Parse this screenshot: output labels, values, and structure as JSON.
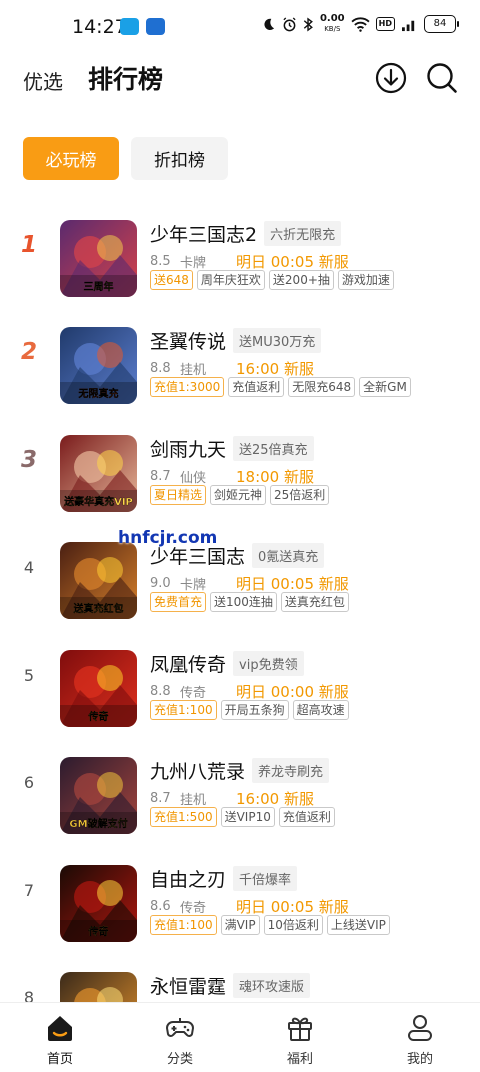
{
  "status_bar": {
    "time": "14:27",
    "net_speed": "0.00",
    "net_unit": "KB/S",
    "hd": "HD",
    "signal": "5G",
    "battery": "84"
  },
  "header": {
    "tab_featured": "优选",
    "tab_ranking": "排行榜",
    "icons": [
      "download-icon",
      "search-icon"
    ]
  },
  "segments": {
    "must_play": "必玩榜",
    "discount": "折扣榜"
  },
  "colors": {
    "accent": "#f99c14",
    "open_time": "#f29800",
    "watermark": "#1337b3"
  },
  "games": [
    {
      "rank": "1",
      "name": "少年三国志2",
      "subtitle": "六折无限充",
      "score": "8.5",
      "genre": "卡牌",
      "open_time": "明日 00:05 新服",
      "tags": [
        {
          "text": "送648",
          "highlight": true
        },
        {
          "text": "周年庆狂欢",
          "highlight": false
        },
        {
          "text": "送200+抽",
          "highlight": false
        },
        {
          "text": "游戏加速",
          "highlight": false
        }
      ],
      "thumb_text": "三周年"
    },
    {
      "rank": "2",
      "name": "圣翼传说",
      "subtitle": "送MU30万充",
      "score": "8.8",
      "genre": "挂机",
      "open_time": "16:00 新服",
      "tags": [
        {
          "text": "充值1:3000",
          "highlight": true
        },
        {
          "text": "充值返利",
          "highlight": false
        },
        {
          "text": "无限充648",
          "highlight": false
        },
        {
          "text": "全新GM",
          "highlight": false
        }
      ],
      "thumb_text": "无限真充"
    },
    {
      "rank": "3",
      "name": "剑雨九天",
      "subtitle": "送25倍真充",
      "score": "8.7",
      "genre": "仙侠",
      "open_time": "18:00 新服",
      "tags": [
        {
          "text": "夏日精选",
          "highlight": true
        },
        {
          "text": "剑姬元神",
          "highlight": false
        },
        {
          "text": "25倍返利",
          "highlight": false
        }
      ],
      "thumb_text": "送豪华真充VIP"
    },
    {
      "rank": "4",
      "name": "少年三国志",
      "subtitle": "0氪送真充",
      "score": "9.0",
      "genre": "卡牌",
      "open_time": "明日 00:05 新服",
      "tags": [
        {
          "text": "免费首充",
          "highlight": true
        },
        {
          "text": "送100连抽",
          "highlight": false
        },
        {
          "text": "送真充红包",
          "highlight": false
        }
      ],
      "thumb_text": "送真充红包"
    },
    {
      "rank": "5",
      "name": "凤凰传奇",
      "subtitle": "vip免费领",
      "score": "8.8",
      "genre": "传奇",
      "open_time": "明日 00:00 新服",
      "tags": [
        {
          "text": "充值1:100",
          "highlight": true
        },
        {
          "text": "开局五条狗",
          "highlight": false
        },
        {
          "text": "超高攻速",
          "highlight": false
        }
      ],
      "thumb_text": "传奇"
    },
    {
      "rank": "6",
      "name": "九州八荒录",
      "subtitle": "养龙寺刷充",
      "score": "8.7",
      "genre": "挂机",
      "open_time": "16:00 新服",
      "tags": [
        {
          "text": "充值1:500",
          "highlight": true
        },
        {
          "text": "送VIP10",
          "highlight": false
        },
        {
          "text": "充值返利",
          "highlight": false
        }
      ],
      "thumb_text": "GM破解支付"
    },
    {
      "rank": "7",
      "name": "自由之刃",
      "subtitle": "千倍爆率",
      "score": "8.6",
      "genre": "传奇",
      "open_time": "明日 00:05 新服",
      "tags": [
        {
          "text": "充值1:100",
          "highlight": true
        },
        {
          "text": "满VIP",
          "highlight": false
        },
        {
          "text": "10倍返利",
          "highlight": false
        },
        {
          "text": "上线送VIP",
          "highlight": false
        }
      ],
      "thumb_text": "传奇"
    },
    {
      "rank": "8",
      "name": "永恒雷霆",
      "subtitle": "魂环攻速版",
      "score": "",
      "genre": "",
      "open_time": "",
      "tags": [],
      "thumb_text": ""
    }
  ],
  "watermark": "hnfcjr.com",
  "bottom_nav": [
    {
      "label": "首页",
      "icon": "home-icon"
    },
    {
      "label": "分类",
      "icon": "gamepad-icon"
    },
    {
      "label": "福利",
      "icon": "gift-icon"
    },
    {
      "label": "我的",
      "icon": "person-icon"
    }
  ]
}
